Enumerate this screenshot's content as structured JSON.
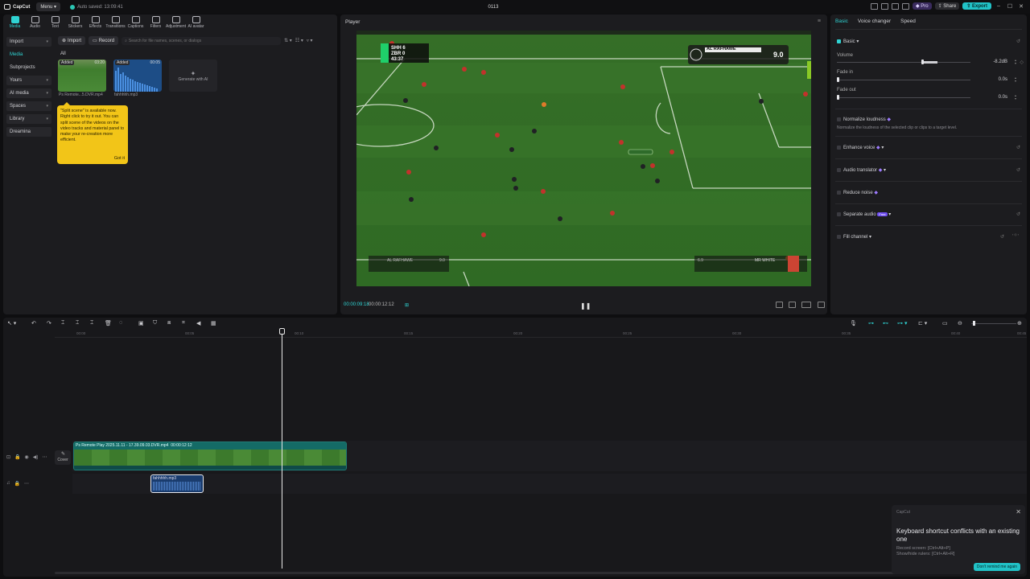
{
  "app": {
    "logo": "CapCut",
    "menu_label": "Menu",
    "autosave": "Auto saved: 13:09:41",
    "project_title": "0113",
    "pro_label": "Pro",
    "share_label": "Share",
    "export_label": "Export"
  },
  "toolbar": {
    "tabs": [
      {
        "label": "Media",
        "icon": "media-icon"
      },
      {
        "label": "Audio",
        "icon": "audio-icon"
      },
      {
        "label": "Text",
        "icon": "text-icon"
      },
      {
        "label": "Stickers",
        "icon": "stickers-icon"
      },
      {
        "label": "Effects",
        "icon": "effects-icon"
      },
      {
        "label": "Transitions",
        "icon": "transitions-icon"
      },
      {
        "label": "Captions",
        "icon": "captions-icon"
      },
      {
        "label": "Filters",
        "icon": "filters-icon"
      },
      {
        "label": "Adjustment",
        "icon": "adjustment-icon"
      },
      {
        "label": "AI avatar",
        "icon": "ai-avatar-icon"
      }
    ]
  },
  "sidenav": {
    "items": [
      "Import",
      "Media",
      "Subprojects",
      "Yours",
      "AI media",
      "Spaces",
      "Library",
      "Dreamina"
    ]
  },
  "media": {
    "import_label": "Import",
    "record_label": "Record",
    "search_placeholder": "Search for file names, scenes, or dialogs",
    "all_label": "All",
    "items": [
      {
        "badge": "Added",
        "duration": "03:20",
        "name": "Ps Remote...5.DVR.mp4"
      },
      {
        "badge": "Added",
        "duration": "00:05",
        "name": "fahhhhh.mp3"
      }
    ],
    "ai_generate_label": "Generate with AI",
    "tooltip_text": "\"Split scene\" is available now. Right click to try it out. You can split scene of the videos on the video tracks and material panel to make your re-creation more efficient.",
    "tooltip_button": "Got it"
  },
  "player": {
    "title": "Player",
    "current_time": "00:00:09:18",
    "total_time": "00:00:12:12",
    "hud": {
      "team1": "SHH",
      "score1": "6",
      "team2": "ZBR",
      "score2": "0",
      "clock": "43:37",
      "player_name": "AL RAFHAWE",
      "rating": "9.0",
      "bottom_left": "AL RAFHAWE",
      "bottom_left_val": "9.0",
      "bottom_right_val": "6.9",
      "bottom_right": "MR WHITE"
    }
  },
  "properties": {
    "tabs": [
      "Basic",
      "Voice changer",
      "Speed"
    ],
    "basic_label": "Basic",
    "volume_label": "Volume",
    "volume_value": "-8.2dB",
    "volume_level": 0.62,
    "fade_in_label": "Fade in",
    "fade_in_value": "0.0s",
    "fade_out_label": "Fade out",
    "fade_out_value": "0.0s",
    "normalize_label": "Normalize loudness",
    "normalize_desc": "Normalize the loudness of the selected clip or clips to a target level.",
    "enhance_label": "Enhance voice",
    "translator_label": "Audio translator",
    "reduce_noise_label": "Reduce noise",
    "separate_label": "Separate audio",
    "separate_badge": "Free",
    "fill_channel_label": "Fill channel"
  },
  "timeline": {
    "ticks": [
      "00:00",
      "00:05",
      "00:10",
      "00:15",
      "00:20",
      "00:25",
      "00:30",
      "00:35",
      "00:40",
      "00:45"
    ],
    "video_clip": {
      "name": "Ps Remote Play 2025.11.11 - 17.39.09.03.DVR.mp4",
      "duration": "00:00:12:12"
    },
    "audio_clip": {
      "name": "fahhhhh.mp3"
    },
    "cover_label": "Cover"
  },
  "toast": {
    "brand": "CapCut",
    "title": "Keyboard shortcut conflicts with an existing one",
    "line1": "Record screen: [Ctrl+Alt+P]",
    "line2": "Show/hide rulers: [Ctrl+Alt+R]",
    "button": "Don't remind me again"
  },
  "colors": {
    "accent": "#2fd3d3",
    "export": "#21c2c7",
    "pitch": "#3f7d2e"
  }
}
